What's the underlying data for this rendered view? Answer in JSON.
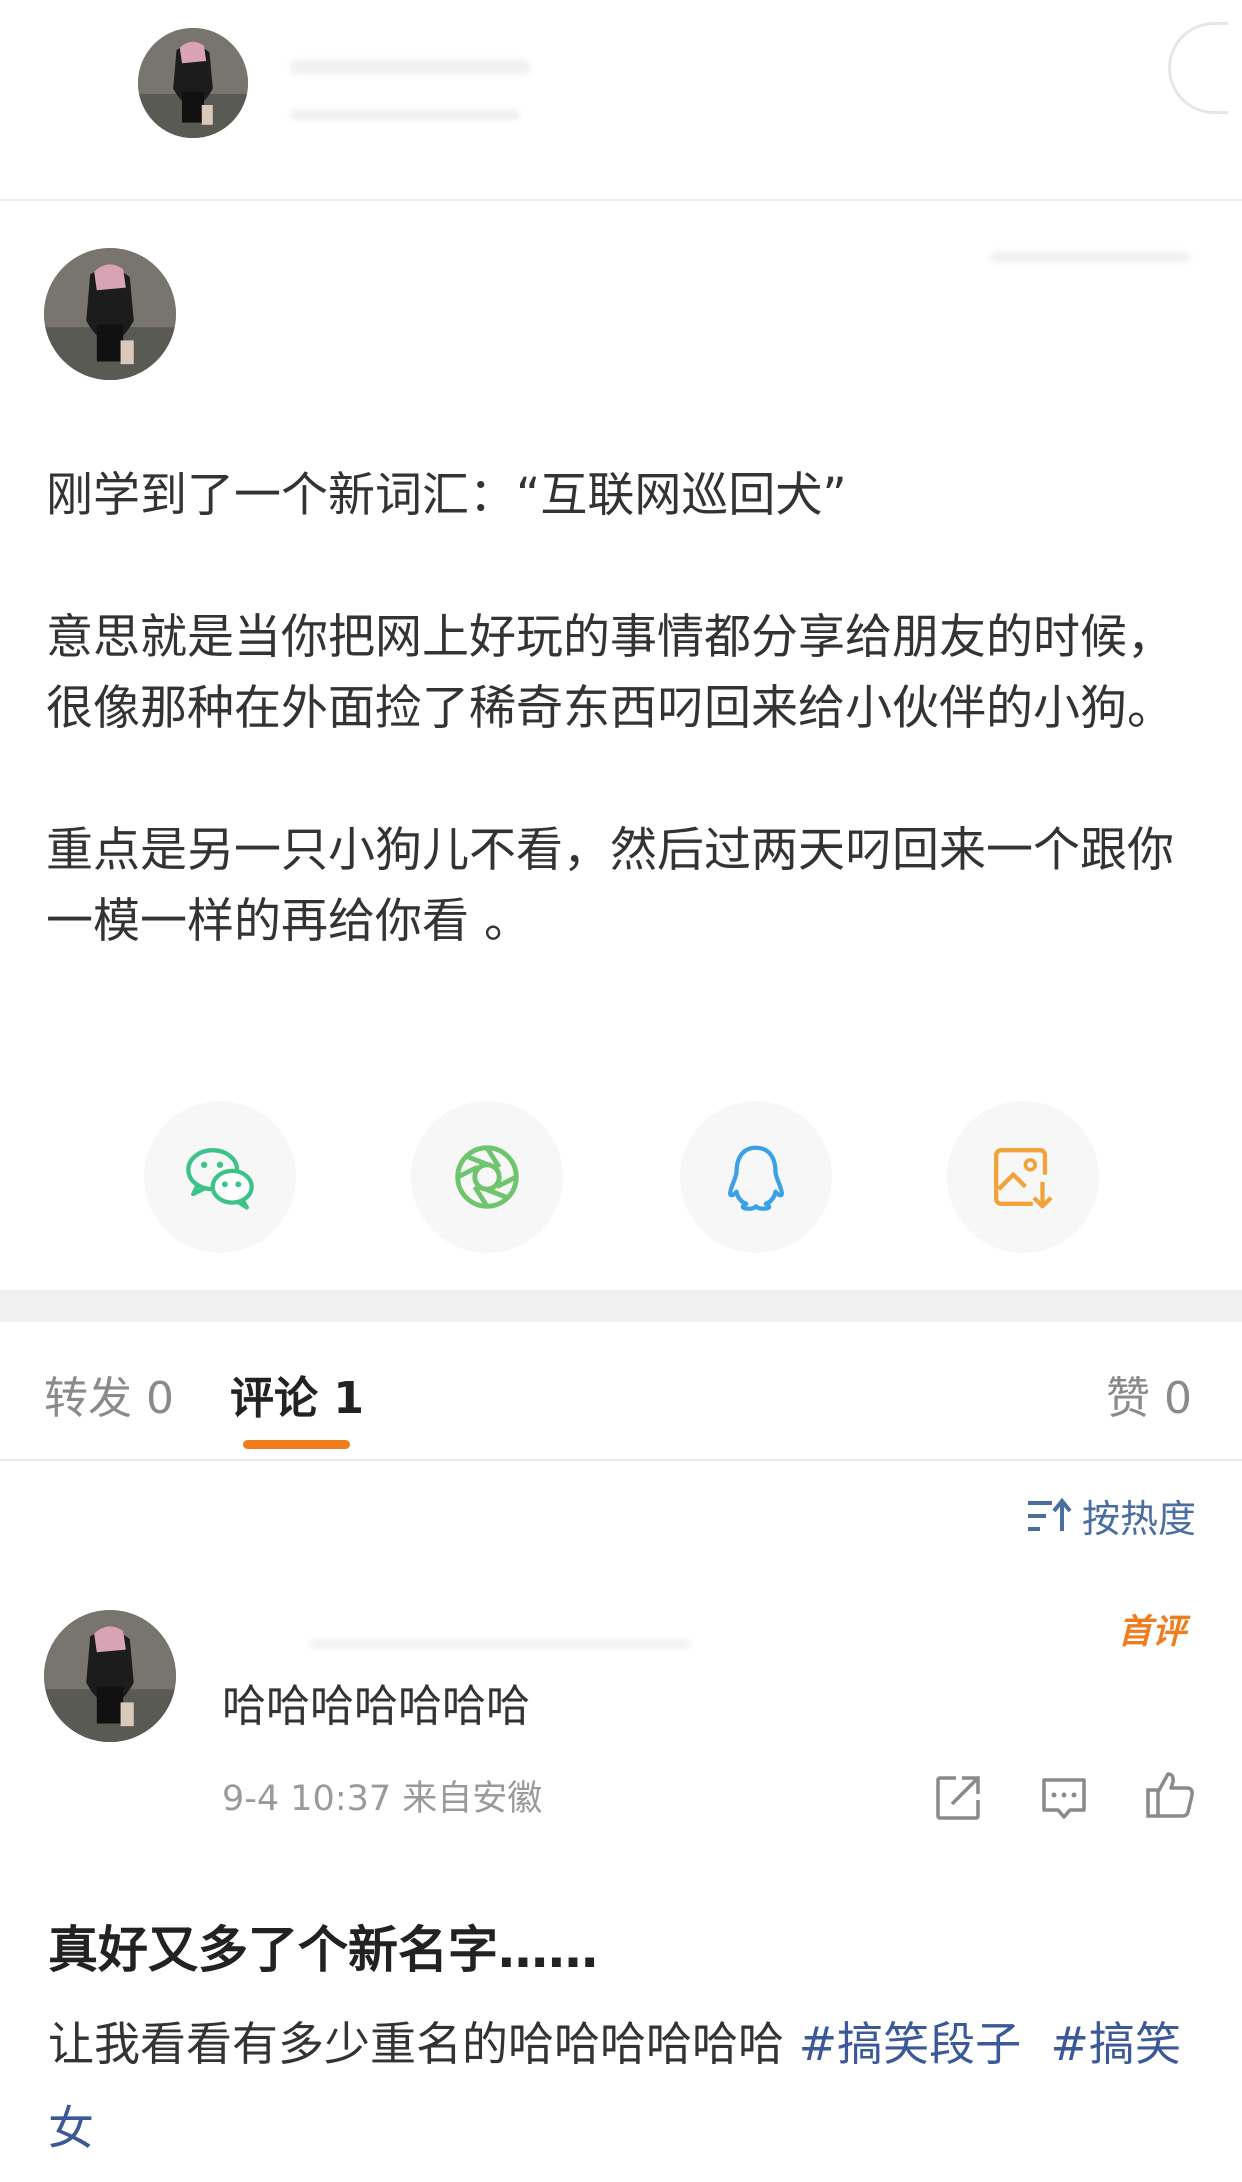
{
  "post": {
    "paragraphs": [
      "刚学到了一个新词汇：“互联网巡回犬”",
      "意思就是当你把网上好玩的事情都分享给朋友的时候，很像那种在外面捡了稀奇东西叼回来给小伙伴的小狗。",
      "重点是另一只小狗儿不看，然后过两天叼回来一个跟你一模一样的再给你看 。"
    ]
  },
  "share": {
    "items": [
      {
        "icon": "wechat-icon",
        "color": "#3cc388"
      },
      {
        "icon": "moments-icon",
        "color": "#6fc46e"
      },
      {
        "icon": "qq-icon",
        "color": "#3aa1e6"
      },
      {
        "icon": "save-image-icon",
        "color": "#f1a33a"
      }
    ]
  },
  "tabs": {
    "repost": "转发 0",
    "comment": "评论 1",
    "like": "赞 0"
  },
  "sort": {
    "label": "按热度"
  },
  "comment": {
    "badge": "首评",
    "text": "哈哈哈哈哈哈哈",
    "meta": "9-4 10:37  来自安徽"
  },
  "footer": {
    "title": "真好又多了个新名字……",
    "text_prefix": "让我看看有多少重名的哈哈哈哈哈哈 ",
    "hashtag1": "#搞笑段子",
    "hashtag2": "#搞笑女"
  },
  "colors": {
    "accent": "#ef7d1e",
    "link": "#3b5998"
  }
}
